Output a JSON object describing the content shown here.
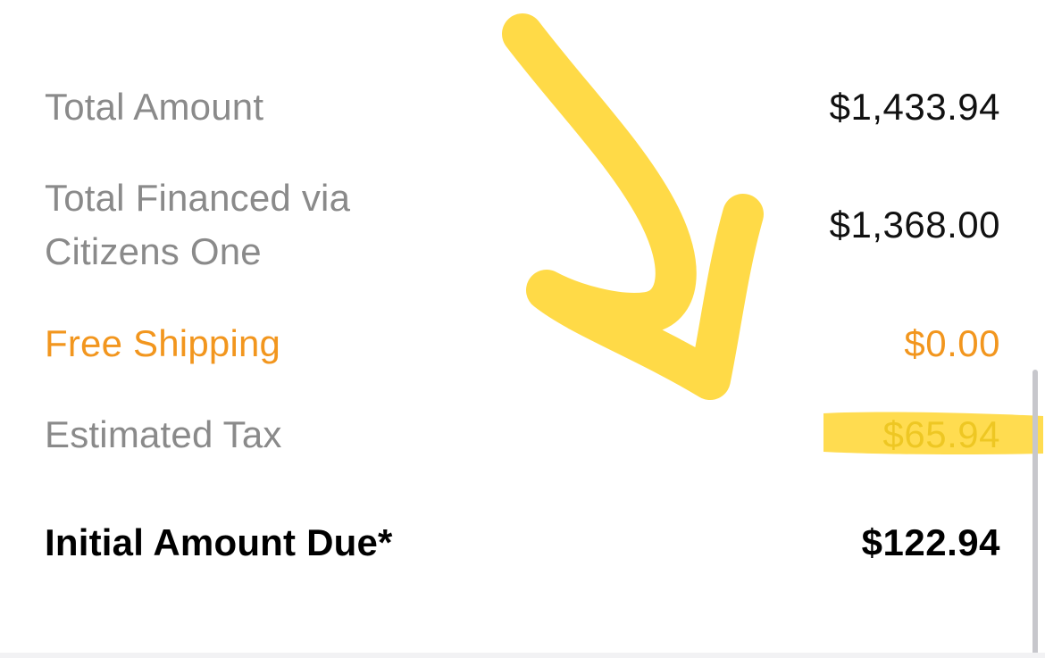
{
  "rows": {
    "total_amount": {
      "label": "Total Amount",
      "value": "$1,433.94"
    },
    "financed": {
      "label_line1": "Total Financed via",
      "label_line2": "Citizens One",
      "value": "$1,368.00"
    },
    "shipping": {
      "label": "Free Shipping",
      "value": "$0.00"
    },
    "tax": {
      "label": "Estimated Tax",
      "value": "$65.94"
    },
    "initial_due": {
      "label": "Initial Amount Due*",
      "value": "$122.94"
    }
  },
  "colors": {
    "label_gray": "#8a8a8a",
    "accent_orange": "#f2961e",
    "highlighter_yellow": "#ffd21f"
  }
}
